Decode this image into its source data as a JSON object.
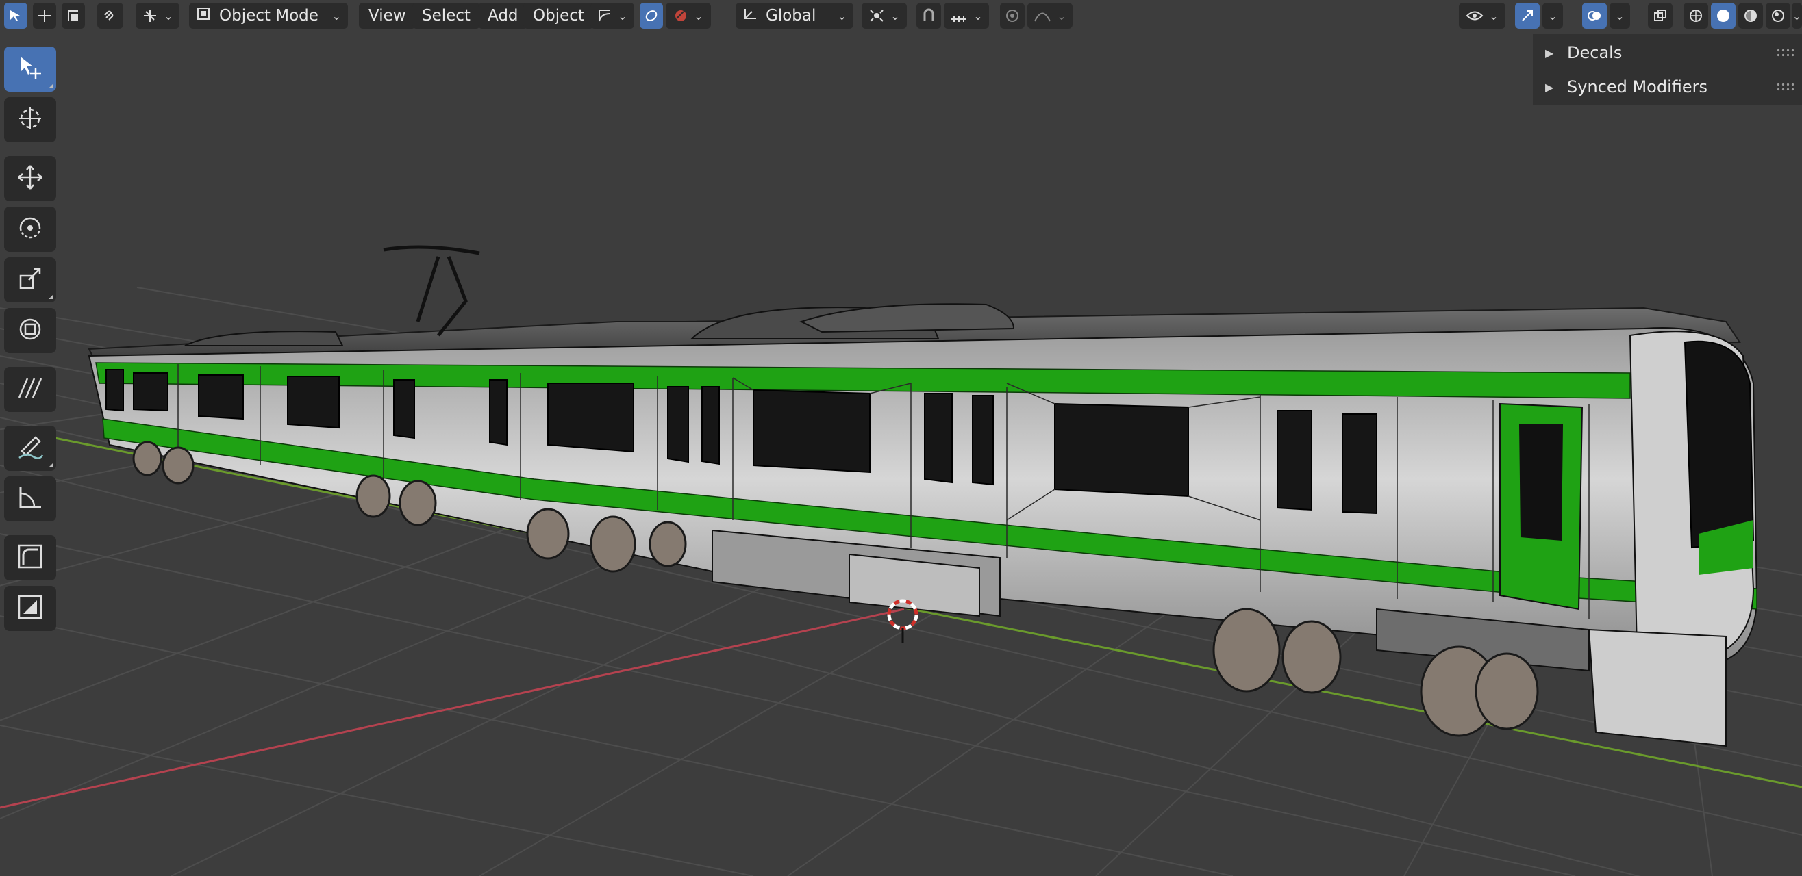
{
  "header": {
    "mode_label": "Object Mode",
    "menu": [
      "View",
      "Select",
      "Add",
      "Object"
    ],
    "orientation_label": "Global",
    "icons": {
      "select_box": "select-box-icon",
      "cursor": "cursor-icon",
      "tweak": "tweak-icon",
      "link": "link-icon",
      "transform_pivot": "pivot-icon",
      "snap": "snap-icon",
      "proportional": "proportional-edit-icon",
      "overlays": "overlays-icon",
      "gizmos": "gizmo-icon",
      "xray": "xray-icon",
      "shading_wire": "wireframe-shading-icon",
      "shading_solid": "solid-shading-icon",
      "shading_material": "material-shading-icon",
      "shading_render": "rendered-shading-icon"
    }
  },
  "toolbar": {
    "tools": [
      "select-tool-icon",
      "cursor-tool-icon",
      "move-tool-icon",
      "rotate-tool-icon",
      "scale-tool-icon",
      "transform-tool-icon",
      "annotate-tool-icon",
      "measure-tool-icon",
      "add-cube-tool-icon"
    ]
  },
  "right_panel": {
    "items": [
      {
        "label": "Decals"
      },
      {
        "label": "Synced Modifiers"
      }
    ]
  },
  "colors": {
    "viewport_bg": "#3d3d3d",
    "grid": "#4a4a4a",
    "x_axis": "#b4424f",
    "y_axis": "#6a9a2c",
    "train_body": "#c8c8c8",
    "train_stripe": "#1fa214",
    "active_tool": "#4772b3"
  }
}
